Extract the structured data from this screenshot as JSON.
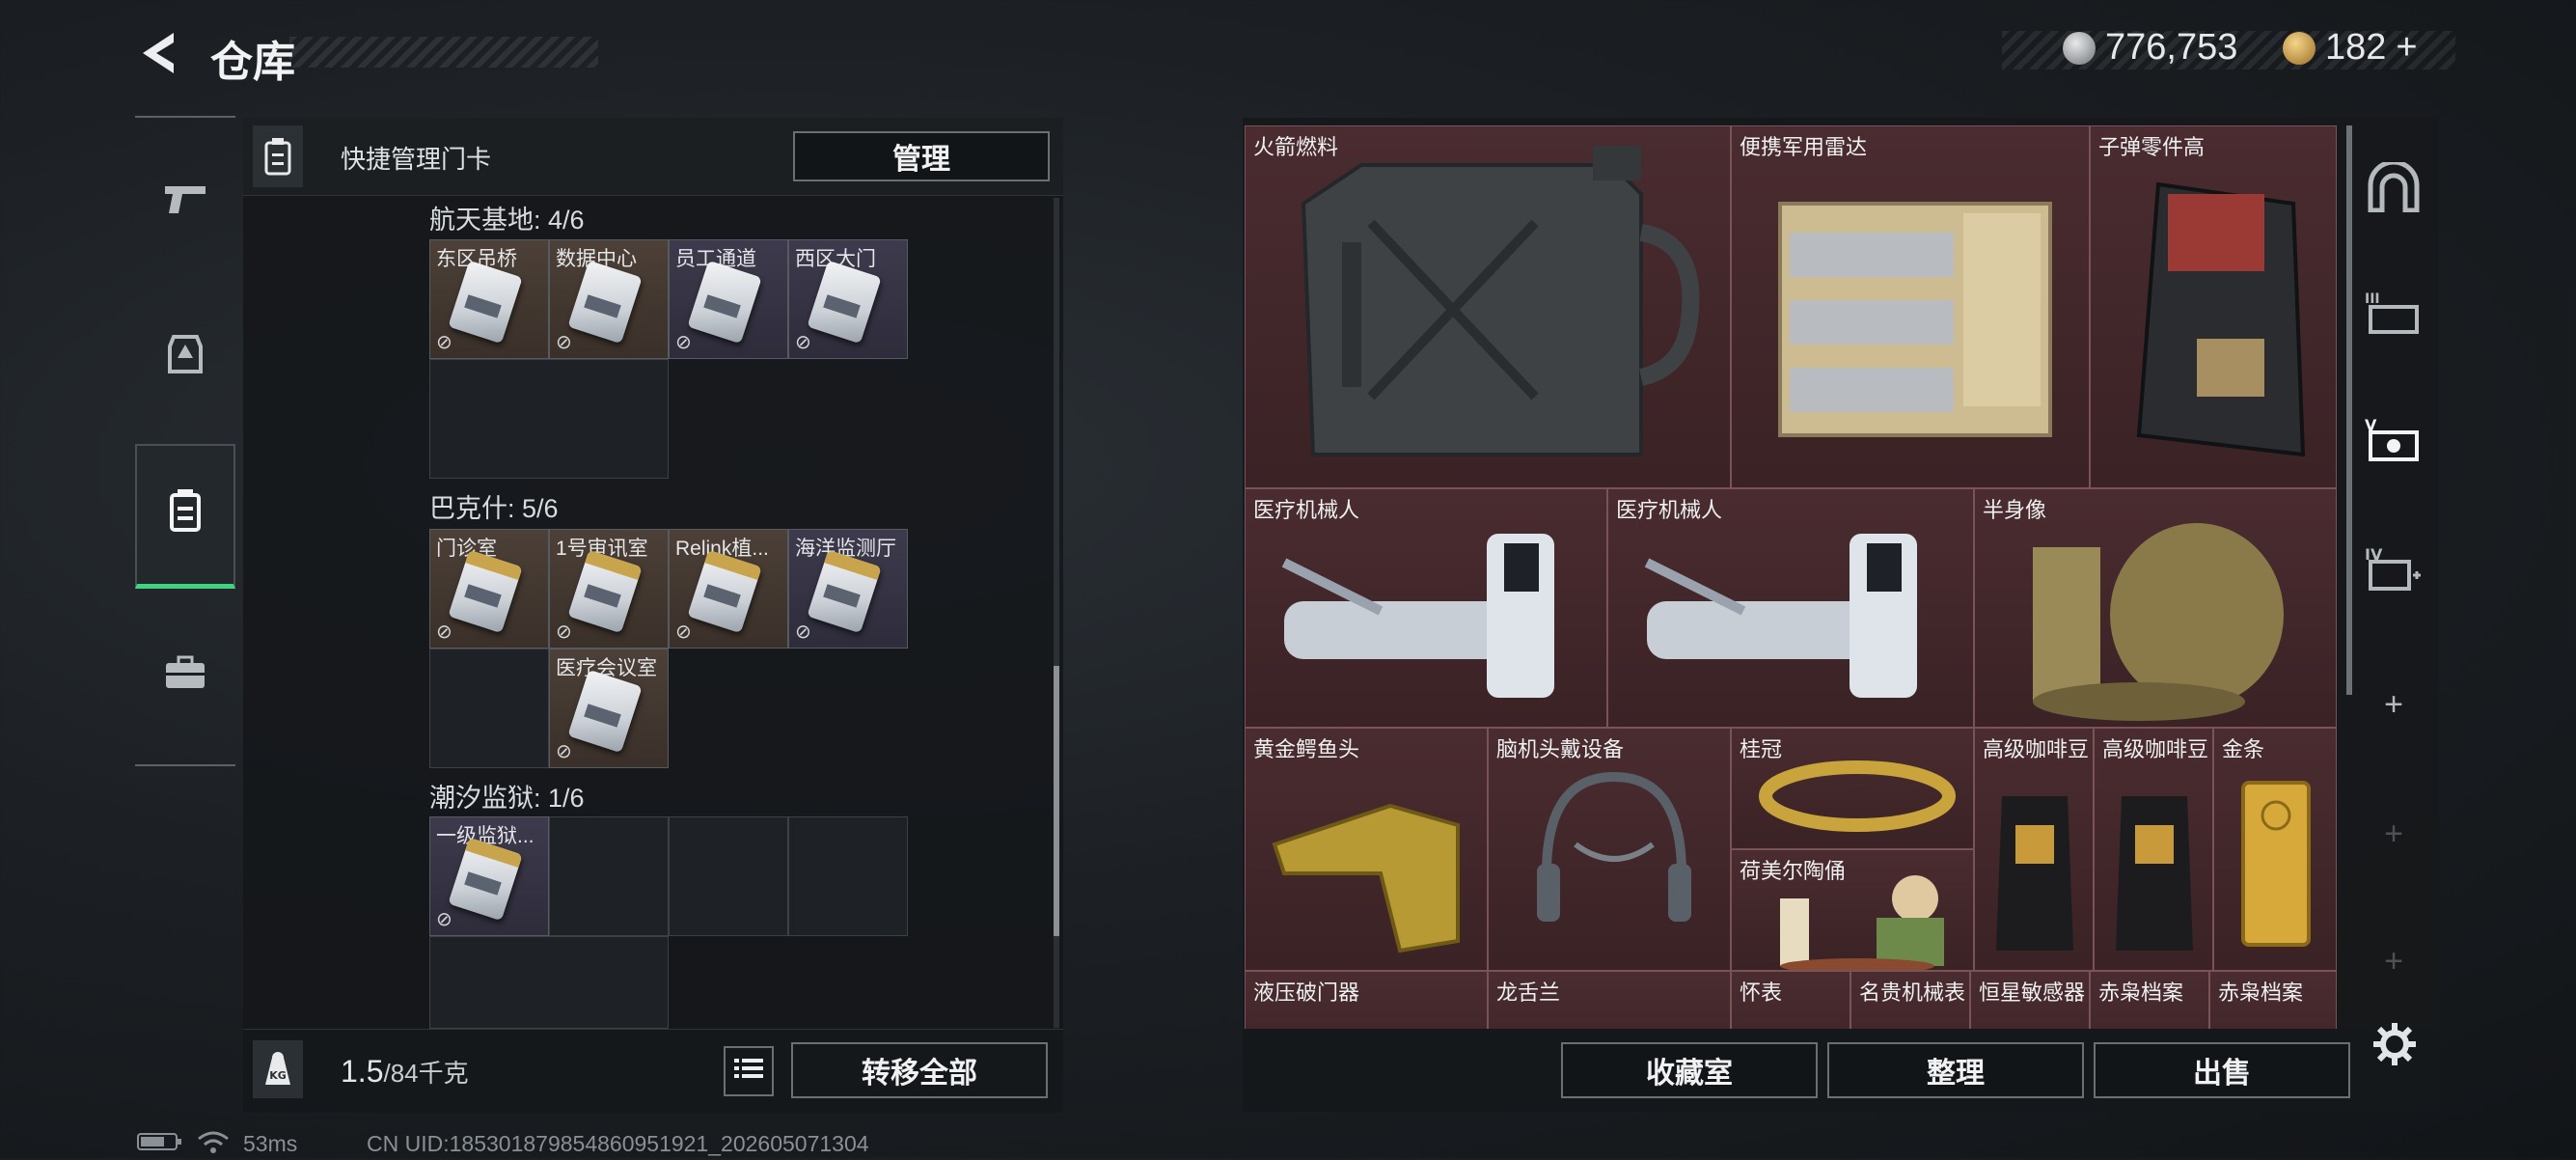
{
  "header": {
    "title": "仓库",
    "back_icon": "back-arrow-icon"
  },
  "currency": {
    "silver": "776,753",
    "gold": "182",
    "gold_plus": "+"
  },
  "left_nav": [
    {
      "name": "weapons-tab",
      "icon": "pistol-icon"
    },
    {
      "name": "equipment-tab",
      "icon": "armor-icon"
    },
    {
      "name": "keycards-tab",
      "icon": "keycard-case-icon",
      "active": true
    },
    {
      "name": "supplies-tab",
      "icon": "briefcase-icon"
    }
  ],
  "keycard_panel": {
    "header_label": "快捷管理门卡",
    "manage_label": "管理",
    "groups": [
      {
        "label": "航天基地: 4/6",
        "cards": [
          {
            "name": "东区吊桥",
            "rarity": "tan"
          },
          {
            "name": "数据中心",
            "rarity": "tan"
          },
          {
            "name": "员工通道",
            "rarity": "purple"
          },
          {
            "name": "西区大门",
            "rarity": "purple"
          }
        ]
      },
      {
        "label": "巴克什: 5/6",
        "cards": [
          {
            "name": "门诊室",
            "rarity": "tan"
          },
          {
            "name": "1号审讯室",
            "rarity": "tan"
          },
          {
            "name": "Relink植...",
            "rarity": "tan"
          },
          {
            "name": "海洋监测厅",
            "rarity": "purple"
          },
          {
            "name": "医疗会议室",
            "rarity": "tan"
          }
        ]
      },
      {
        "label": "潮汐监狱: 1/6",
        "cards": [
          {
            "name": "一级监狱...",
            "rarity": "purple"
          }
        ]
      }
    ],
    "weight_value": "1.5",
    "weight_max": "/84千克",
    "transfer_label": "转移全部"
  },
  "status_bar": {
    "ping": "53ms",
    "uid": "CN UID:1853018798548609519​21_202605071304"
  },
  "collection": {
    "items": [
      {
        "name": "火箭燃料"
      },
      {
        "name": "便携军用雷达"
      },
      {
        "name": "子弹零件高"
      },
      {
        "name": "医疗机械人"
      },
      {
        "name": "医疗机械人"
      },
      {
        "name": "半身像"
      },
      {
        "name": "黄金鳄鱼头"
      },
      {
        "name": "脑机头戴设备"
      },
      {
        "name": "桂冠"
      },
      {
        "name": "荷美尔陶俑"
      },
      {
        "name": "高级咖啡豆"
      },
      {
        "name": "高级咖啡豆"
      },
      {
        "name": "金条"
      },
      {
        "name": "液压破门器"
      },
      {
        "name": "龙舌兰"
      },
      {
        "name": "怀表"
      },
      {
        "name": "名贵机械表"
      },
      {
        "name": "恒星敏感器"
      },
      {
        "name": "赤枭档案"
      },
      {
        "name": "赤枭档案"
      }
    ],
    "buttons": {
      "vault": "收藏室",
      "sort": "整理",
      "sell": "出售"
    }
  },
  "right_nav": [
    {
      "name": "collection-room-tab",
      "icon": "arch-icon"
    },
    {
      "name": "stash-3-tab",
      "icon": "stash-III-icon"
    },
    {
      "name": "stash-5-tab",
      "icon": "stash-V-icon",
      "active": true
    },
    {
      "name": "stash-4-tab",
      "icon": "stash-IV-icon"
    },
    {
      "name": "add-stash-1",
      "icon": "plus-icon"
    },
    {
      "name": "add-stash-2",
      "icon": "plus-icon"
    },
    {
      "name": "add-stash-3",
      "icon": "plus-icon"
    }
  ],
  "colors": {
    "accent_green": "#3fd37f",
    "item_bg_red": "#4a2c30",
    "card_tan": "#4c4038",
    "card_purple": "#3d3a4d"
  }
}
